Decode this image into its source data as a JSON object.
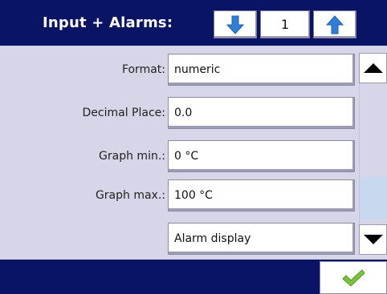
{
  "header": {
    "title": "Input + Alarms:",
    "channel_number": "1",
    "prev_icon": "arrow-down-icon",
    "next_icon": "arrow-up-icon"
  },
  "settings": [
    {
      "label": "Format:",
      "value": "numeric"
    },
    {
      "label": "Decimal Place:",
      "value": "0.0"
    },
    {
      "label": "Graph min.:",
      "value": "0 °C"
    },
    {
      "label": "Graph max.:",
      "value": "100 °C"
    },
    {
      "label": "",
      "value": "Alarm display"
    }
  ],
  "scrollbar": {
    "up_icon": "triangle-up-icon",
    "down_icon": "triangle-down-icon"
  },
  "footer": {
    "confirm_icon": "checkmark-icon"
  },
  "colors": {
    "bar": "#0a1464",
    "panel": "#d6d6e8",
    "arrow_blue": "#2f7fd8",
    "check_green": "#7cc23a"
  }
}
